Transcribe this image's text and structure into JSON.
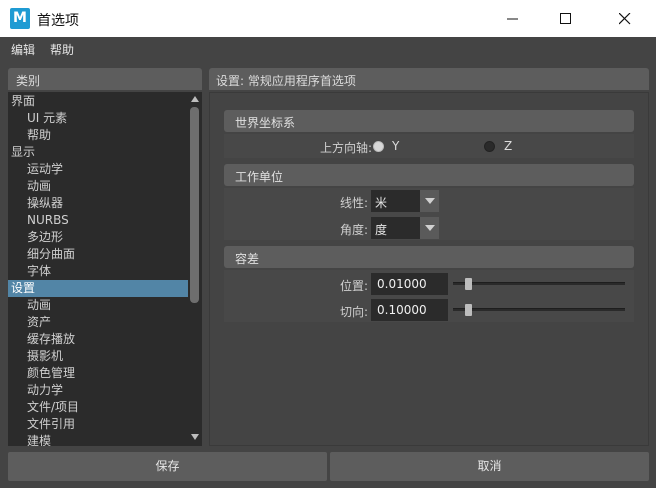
{
  "window": {
    "title": "首选项",
    "logo_letter": "M"
  },
  "menu": {
    "edit": "编辑",
    "help": "帮助"
  },
  "left_panel": {
    "header": "类别",
    "items": [
      {
        "label": "界面",
        "level": 0
      },
      {
        "label": "UI 元素",
        "level": 1
      },
      {
        "label": "帮助",
        "level": 1
      },
      {
        "label": "显示",
        "level": 0
      },
      {
        "label": "运动学",
        "level": 1
      },
      {
        "label": "动画",
        "level": 1
      },
      {
        "label": "操纵器",
        "level": 1
      },
      {
        "label": "NURBS",
        "level": 1
      },
      {
        "label": "多边形",
        "level": 1
      },
      {
        "label": "细分曲面",
        "level": 1
      },
      {
        "label": "字体",
        "level": 1
      },
      {
        "label": "设置",
        "level": 0,
        "selected": true
      },
      {
        "label": "动画",
        "level": 1
      },
      {
        "label": "资产",
        "level": 1
      },
      {
        "label": "缓存播放",
        "level": 1
      },
      {
        "label": "摄影机",
        "level": 1
      },
      {
        "label": "颜色管理",
        "level": 1
      },
      {
        "label": "动力学",
        "level": 1
      },
      {
        "label": "文件/项目",
        "level": 1
      },
      {
        "label": "文件引用",
        "level": 1
      },
      {
        "label": "建模",
        "level": 1
      }
    ]
  },
  "right_panel": {
    "header": "设置: 常规应用程序首选项",
    "world_coords": {
      "title": "世界坐标系",
      "up_axis_label": "上方向轴:",
      "options": [
        "Y",
        "Z"
      ],
      "selected": "Y"
    },
    "working_units": {
      "title": "工作单位",
      "linear_label": "线性:",
      "linear_value": "米",
      "angular_label": "角度:",
      "angular_value": "度"
    },
    "tolerance": {
      "title": "容差",
      "position_label": "位置:",
      "position_value": "0.01000",
      "position_slider": 0.1,
      "tangent_label": "切向:",
      "tangent_value": "0.10000",
      "tangent_slider": 0.1
    }
  },
  "footer": {
    "save": "保存",
    "cancel": "取消"
  },
  "colors": {
    "accent_selected": "#5285a6",
    "logo_blue": "#1f9bd3",
    "panel_bg": "#444444",
    "header_bg": "#5d5d5d",
    "list_bg": "#2b2b2b"
  }
}
